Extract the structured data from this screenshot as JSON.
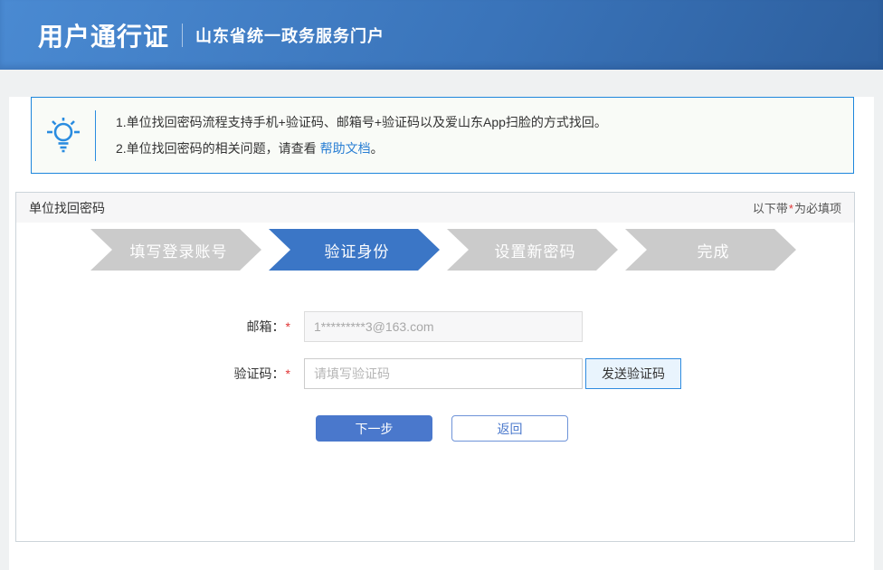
{
  "header": {
    "title": "用户通行证",
    "subtitle": "山东省统一政务服务门户"
  },
  "notice": {
    "line1": "1.单位找回密码流程支持手机+验证码、邮箱号+验证码以及爱山东App扫脸的方式找回。",
    "line2_prefix": "2.单位找回密码的相关问题，请查看 ",
    "line2_link": "帮助文档",
    "line2_suffix": "。"
  },
  "section": {
    "title": "单位找回密码",
    "required_prefix": "以下带",
    "required_star": "*",
    "required_suffix": "为必填项"
  },
  "steps": [
    {
      "label": "填写登录账号",
      "state": "done"
    },
    {
      "label": "验证身份",
      "state": "active"
    },
    {
      "label": "设置新密码",
      "state": "upcoming"
    },
    {
      "label": "完成",
      "state": "upcoming"
    }
  ],
  "form": {
    "email": {
      "label": "邮箱：",
      "required": "*",
      "value": "1*********3@163.com"
    },
    "code": {
      "label": "验证码：",
      "required": "*",
      "placeholder": "请填写验证码",
      "send_button": "发送验证码"
    },
    "next_button": "下一步",
    "back_button": "返回"
  },
  "colors": {
    "header_gradient_start": "#4a8ad2",
    "header_gradient_end": "#2d5f9e",
    "step_active_blue": "#3b76c6",
    "step_inactive_gray": "#cbcbcb",
    "notice_border_blue": "#1d86dc",
    "link_blue": "#2a7fd4",
    "primary_button_blue": "#4a78cc",
    "send_button_bg": "#e9f4fd",
    "send_button_border": "#2f8be0",
    "required_red": "#e03535",
    "page_background": "#eff1f2"
  }
}
